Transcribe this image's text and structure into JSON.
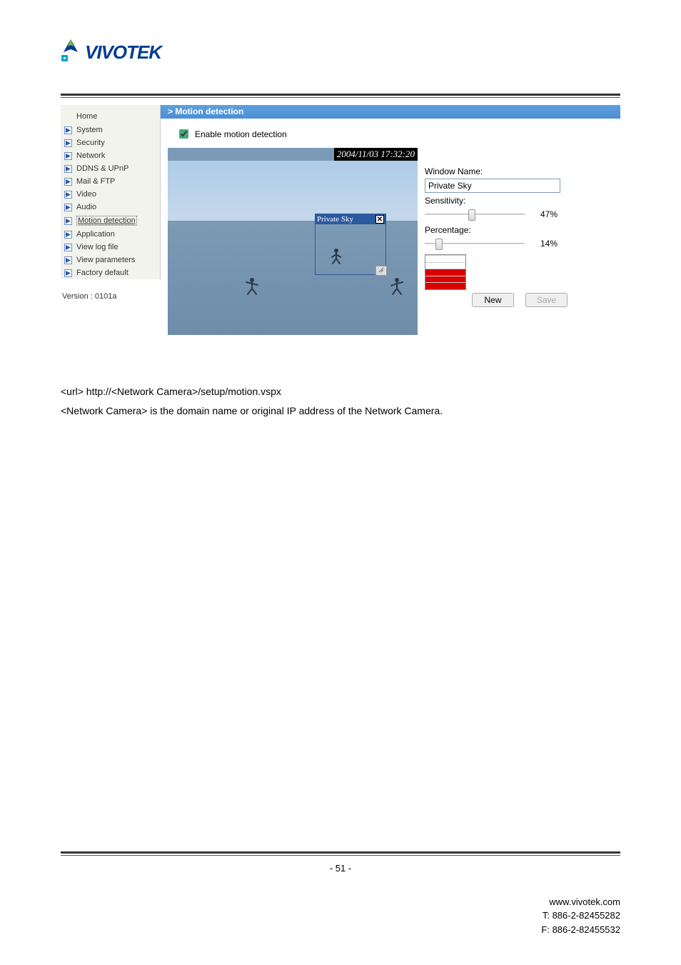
{
  "logo": {
    "text": "VIVOTEK"
  },
  "sidebar": {
    "home": "Home",
    "items": [
      {
        "label": "System"
      },
      {
        "label": "Security"
      },
      {
        "label": "Network"
      },
      {
        "label": "DDNS & UPnP"
      },
      {
        "label": "Mail & FTP"
      },
      {
        "label": "Video"
      },
      {
        "label": "Audio"
      },
      {
        "label": "Motion detection",
        "selected": true
      },
      {
        "label": "Application"
      },
      {
        "label": "View log file"
      },
      {
        "label": "View parameters"
      },
      {
        "label": "Factory default"
      }
    ],
    "version": "Version : 0101a"
  },
  "panel": {
    "title_prefix": "> ",
    "title": "Motion detection",
    "enable_label": "Enable motion detection",
    "enable_checked": true,
    "timestamp": "2004/11/03 17:32:20",
    "region": {
      "name": "Private Sky",
      "close": "✕"
    },
    "controls": {
      "window_name_label": "Window Name:",
      "window_name_value": "Private Sky",
      "sensitivity_label": "Sensitivity:",
      "sensitivity_value": "47%",
      "sensitivity_pct": 47,
      "percentage_label": "Percentage:",
      "percentage_value": "14%",
      "percentage_pct": 14,
      "new_btn": "New",
      "save_btn": "Save"
    }
  },
  "body": {
    "line1": "<url> http://<Network Camera>/setup/motion.vspx",
    "line2": "<Network Camera> is the domain name or original IP address of the Network Camera."
  },
  "footer": {
    "page": "- 51 -",
    "site": "www.vivotek.com",
    "tel": "T: 886-2-82455282",
    "fax": "F: 886-2-82455532"
  }
}
